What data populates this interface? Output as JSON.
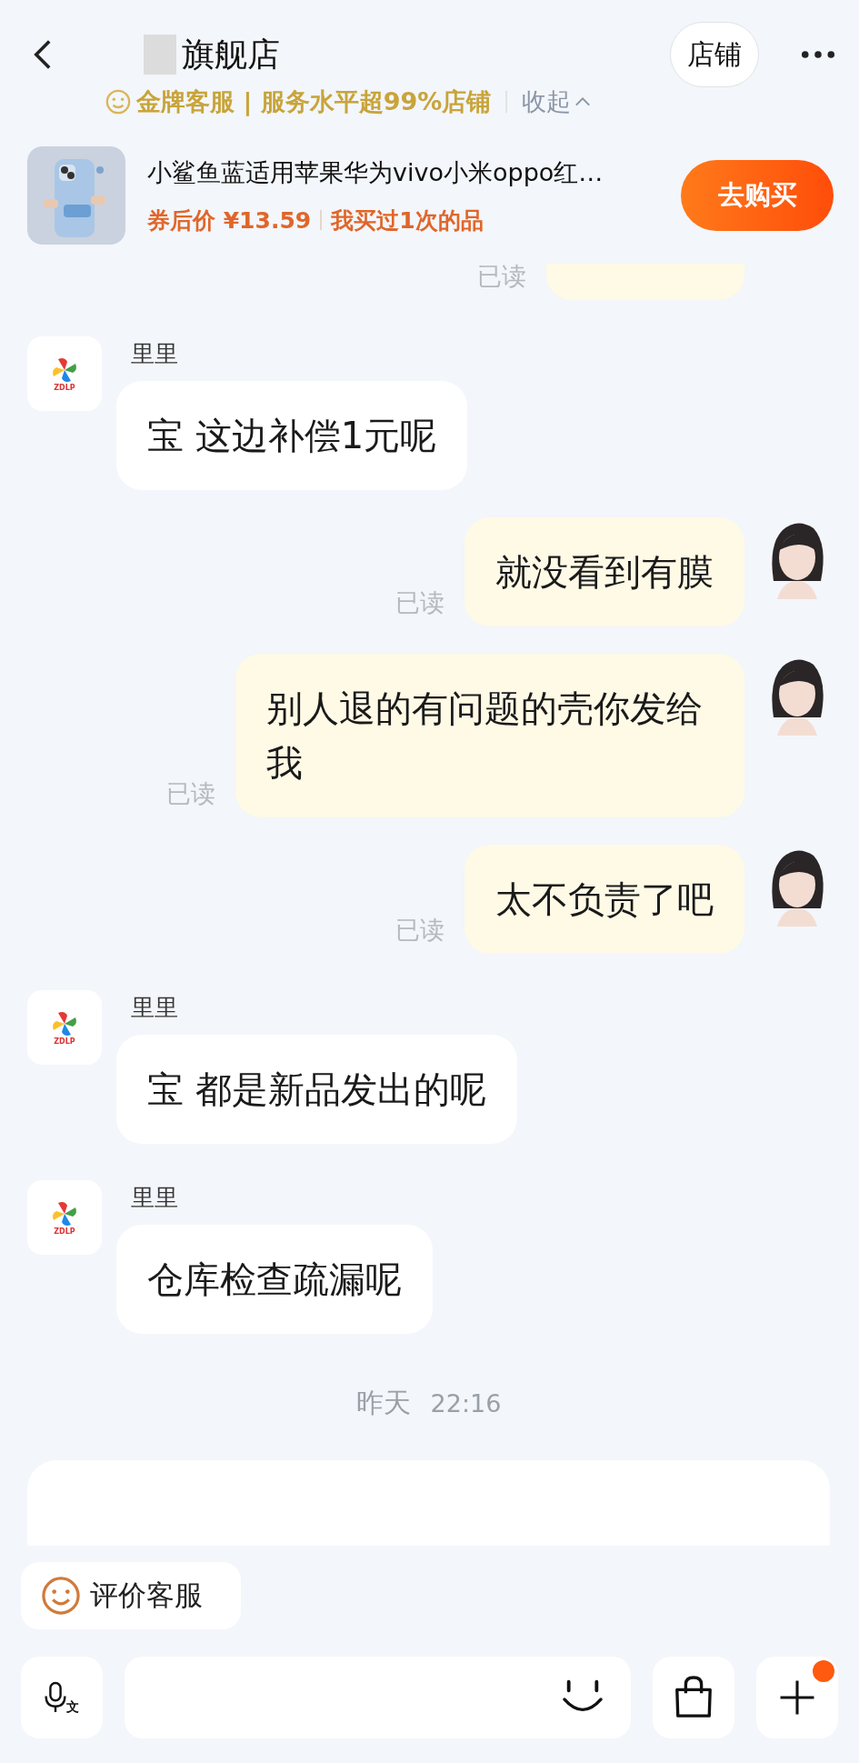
{
  "header": {
    "title": "旗舰店",
    "badge": "金牌客服 | 服务水平超99%店铺",
    "collapse": "收起",
    "shop_button": "店铺"
  },
  "product": {
    "title": "小鲨鱼蓝适用苹果华为vivo小米oppo红…",
    "price": "券后价 ¥13.59",
    "note": "我买过1次的品",
    "buy_button": "去购买"
  },
  "messages": [
    {
      "kind": "sent_cut",
      "read_label": "已读"
    },
    {
      "kind": "received",
      "name": "里里",
      "avatar_label": "ZDLP",
      "text": "宝 这边补偿1元呢"
    },
    {
      "kind": "sent",
      "text": "就没看到有膜",
      "read_label": "已读"
    },
    {
      "kind": "sent",
      "text": "别人退的有问题的壳你发给我",
      "read_label": "已读"
    },
    {
      "kind": "sent",
      "text": "太不负责了吧",
      "read_label": "已读"
    },
    {
      "kind": "received",
      "name": "里里",
      "avatar_label": "ZDLP",
      "text": "宝 都是新品发出的呢"
    },
    {
      "kind": "received",
      "name": "里里",
      "avatar_label": "ZDLP",
      "text": "仓库检查疏漏呢"
    }
  ],
  "timestamp": {
    "day": "昨天",
    "time": "22:16"
  },
  "rate_button": "评价客服",
  "composer": {
    "voice_badge": "文",
    "plus_dot": true
  }
}
